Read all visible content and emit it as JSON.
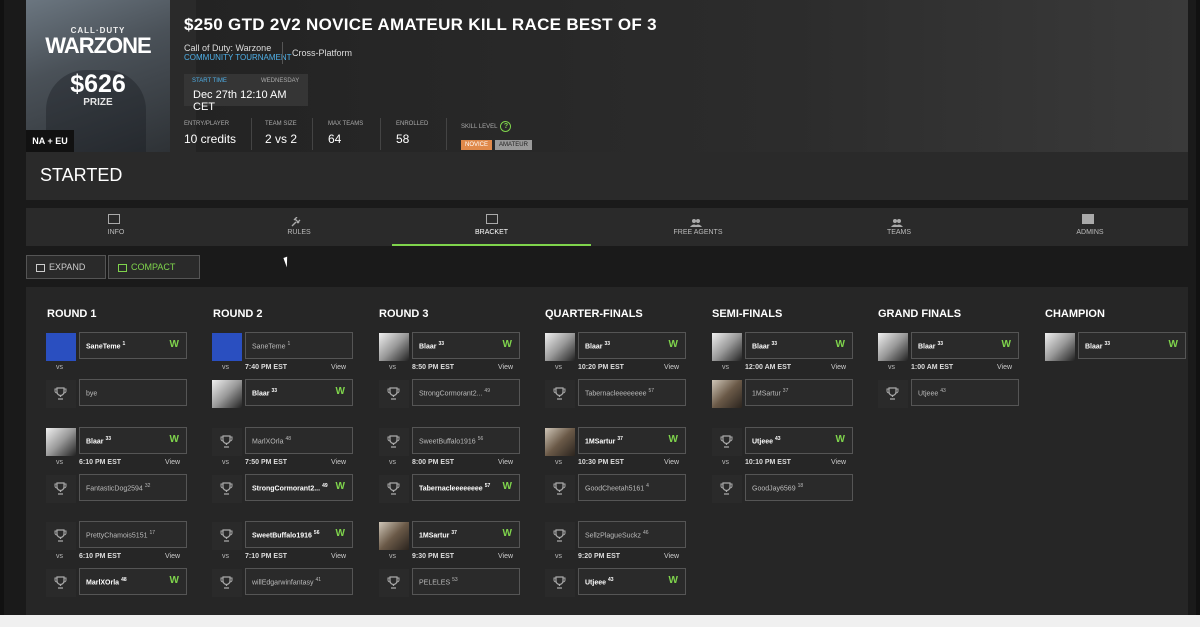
{
  "poster": {
    "game_logo_top": "CALL·DUTY",
    "game_logo": "WARZONE",
    "amount": "$626",
    "prize_label": "PRIZE",
    "region": "NA + EU"
  },
  "tournament": {
    "title": "$250 GTD 2V2 NOVICE AMATEUR KILL RACE BEST OF 3",
    "game": "Call of Duty: Warzone",
    "type": "COMMUNITY TOURNAMENT",
    "platform": "Cross-Platform",
    "start_time_label": "START TIME",
    "weekday": "WEDNESDAY",
    "start_date": "Dec 27th 12:10 AM CET",
    "stats": [
      {
        "label": "ENTRY/PLAYER",
        "value": "10 credits"
      },
      {
        "label": "TEAM SIZE",
        "value": "2 vs 2"
      },
      {
        "label": "MAX TEAMS",
        "value": "64"
      },
      {
        "label": "ENROLLED",
        "value": "58"
      }
    ],
    "skill_label": "SKILL LEVEL",
    "skill_levels": [
      "NOVICE",
      "AMATEUR"
    ],
    "status": "STARTED"
  },
  "tabs": [
    {
      "label": "INFO",
      "icon": "info-icon"
    },
    {
      "label": "RULES",
      "icon": "gavel-icon"
    },
    {
      "label": "BRACKET",
      "icon": "bracket-icon",
      "active": true
    },
    {
      "label": "FREE AGENTS",
      "icon": "users-add-icon"
    },
    {
      "label": "TEAMS",
      "icon": "teams-icon"
    },
    {
      "label": "ADMINS",
      "icon": "admin-icon"
    }
  ],
  "view_buttons": {
    "expand": "EXPAND",
    "compact": "COMPACT"
  },
  "rounds": [
    "ROUND 1",
    "ROUND 2",
    "ROUND 3",
    "QUARTER-FINALS",
    "SEMI-FINALS",
    "GRAND FINALS",
    "CHAMPION"
  ],
  "vs": "vs",
  "view": "View",
  "win": "W",
  "matches": {
    "r1m1": {
      "time": "",
      "a": {
        "name": "SaneTeme",
        "seed": "1",
        "win": true
      },
      "b": {
        "name": "bye",
        "seed": "",
        "win": false
      }
    },
    "r1m2": {
      "time": "6:10 PM EST",
      "a": {
        "name": "Blaar",
        "seed": "33",
        "win": true
      },
      "b": {
        "name": "FantasticDog2594",
        "seed": "32",
        "win": false
      }
    },
    "r1m3": {
      "time": "6:10 PM EST",
      "a": {
        "name": "PrettyChamois5151",
        "seed": "17",
        "win": false
      },
      "b": {
        "name": "MarlXOrla",
        "seed": "48",
        "win": true
      }
    },
    "r2m1": {
      "time": "7:40 PM EST",
      "a": {
        "name": "SaneTeme",
        "seed": "1",
        "win": false
      },
      "b": {
        "name": "Blaar",
        "seed": "33",
        "win": true
      }
    },
    "r2m2": {
      "time": "7:50 PM EST",
      "a": {
        "name": "MarlXOrla",
        "seed": "48",
        "win": false
      },
      "b": {
        "name": "StrongCormorant2...",
        "seed": "49",
        "win": true
      }
    },
    "r2m3": {
      "time": "7:10 PM EST",
      "a": {
        "name": "SweetBuffalo1916",
        "seed": "56",
        "win": true
      },
      "b": {
        "name": "willEdgarwinfantasy",
        "seed": "41",
        "win": false
      }
    },
    "r3m1": {
      "time": "8:50 PM EST",
      "a": {
        "name": "Blaar",
        "seed": "33",
        "win": true
      },
      "b": {
        "name": "StrongCormorant2...",
        "seed": "49",
        "win": false
      }
    },
    "r3m2": {
      "time": "8:00 PM EST",
      "a": {
        "name": "SweetBuffalo1916",
        "seed": "56",
        "win": false
      },
      "b": {
        "name": "Tabernacleeeeeeee",
        "seed": "57",
        "win": true
      }
    },
    "r3m3": {
      "time": "9:30 PM EST",
      "a": {
        "name": "1MSartur",
        "seed": "37",
        "win": true
      },
      "b": {
        "name": "PELELES",
        "seed": "53",
        "win": false
      }
    },
    "qf1": {
      "time": "10:20 PM EST",
      "a": {
        "name": "Blaar",
        "seed": "33",
        "win": true
      },
      "b": {
        "name": "Tabernacleeeeeeee",
        "seed": "57",
        "win": false
      }
    },
    "qf2": {
      "time": "10:30 PM EST",
      "a": {
        "name": "1MSartur",
        "seed": "37",
        "win": true
      },
      "b": {
        "name": "GoodCheetah5161",
        "seed": "4",
        "win": false
      }
    },
    "qf3": {
      "time": "9:20 PM EST",
      "a": {
        "name": "SellzPlagueSuckz",
        "seed": "46",
        "win": false
      },
      "b": {
        "name": "Utjeee",
        "seed": "43",
        "win": true
      }
    },
    "sf1": {
      "time": "12:00 AM EST",
      "a": {
        "name": "Blaar",
        "seed": "33",
        "win": true
      },
      "b": {
        "name": "1MSartur",
        "seed": "37",
        "win": false
      }
    },
    "sf2": {
      "time": "10:10 PM EST",
      "a": {
        "name": "Utjeee",
        "seed": "43",
        "win": true
      },
      "b": {
        "name": "GoodJay6569",
        "seed": "18",
        "win": false
      }
    },
    "gf": {
      "time": "1:00 AM EST",
      "a": {
        "name": "Blaar",
        "seed": "33",
        "win": true
      },
      "b": {
        "name": "Utjeee",
        "seed": "43",
        "win": false
      }
    },
    "champ": {
      "name": "Blaar",
      "seed": "33",
      "win": true
    }
  },
  "colors": {
    "accent": "#7fd44c",
    "link": "#4fb0e8",
    "novice": "#e0894a"
  }
}
